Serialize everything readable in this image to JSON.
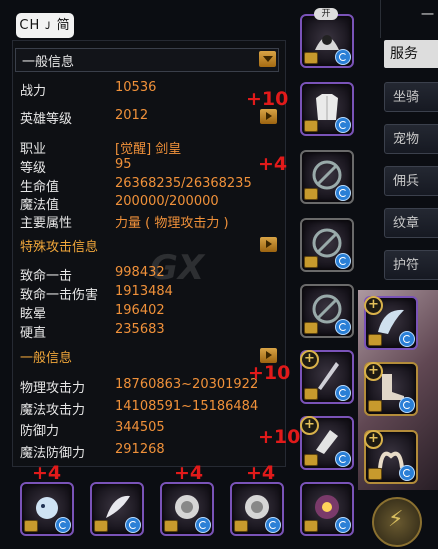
{
  "ime": {
    "label": "CH ᴊ 简"
  },
  "panel": {
    "header": "一般信息",
    "rows": [
      {
        "label": "战力",
        "value": "10536"
      },
      {
        "label": "英雄等级",
        "value": "2012"
      },
      {
        "label": "职业",
        "value": "[觉醒] 剑皇"
      },
      {
        "label": "等级",
        "value": "95"
      },
      {
        "label": "生命值",
        "value": "26368235/26368235"
      },
      {
        "label": "魔法值",
        "value": "200000/200000"
      },
      {
        "label": "主要属性",
        "value": "力量 ( 物理攻击力 )"
      },
      {
        "label": "致命一击",
        "value": "998432"
      },
      {
        "label": "致命一击伤害",
        "value": "1913484"
      },
      {
        "label": "眩晕",
        "value": "196402"
      },
      {
        "label": "硬直",
        "value": "235683"
      },
      {
        "label": "物理攻击力",
        "value": "18760863~20301922"
      },
      {
        "label": "魔法攻击力",
        "value": "14108591~15186484"
      },
      {
        "label": "防御力",
        "value": "344505"
      },
      {
        "label": "魔法防御力",
        "value": "291268"
      }
    ],
    "sections": {
      "special": "特殊攻击信息",
      "general": "一般信息"
    }
  },
  "enhance": {
    "e1": "+10",
    "e2": "+4",
    "e3": "+10",
    "e4": "+10",
    "b1": "+4",
    "b2": "+4",
    "b3": "+4"
  },
  "helmet_badge": "开",
  "right_tabs": {
    "top": "一",
    "server": "服务",
    "t1": "坐骑",
    "t2": "宠物",
    "t3": "佣兵",
    "t4": "纹章",
    "t5": "护符"
  },
  "watermark": "GX",
  "colors": {
    "value": "#f0913a",
    "section": "#f0a63a",
    "enhance": "#e11a1a"
  }
}
